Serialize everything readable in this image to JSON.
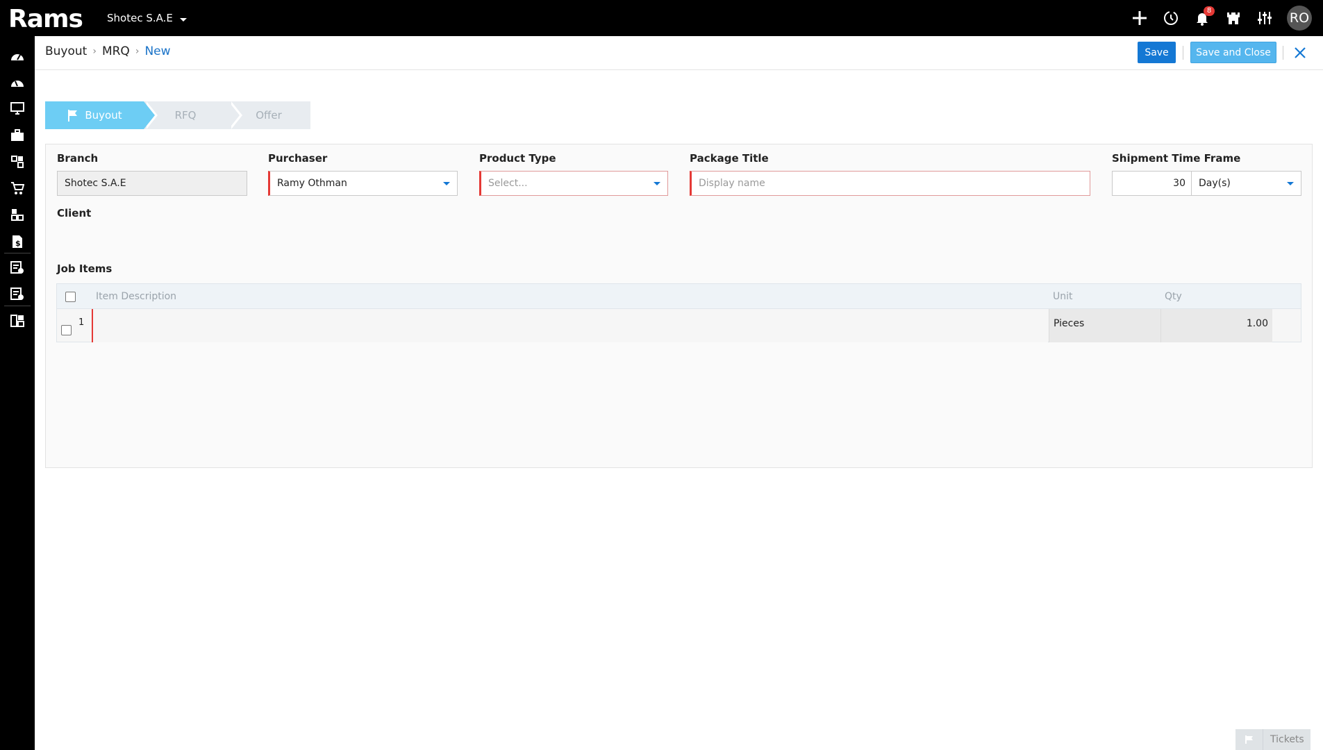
{
  "app": {
    "logo_text": "Rams",
    "company": "Shotec S.A.E",
    "notification_count": "8",
    "user_initials": "RO"
  },
  "sidebar": {
    "items": [
      {
        "icon": "dashboard-icon"
      },
      {
        "icon": "dashboard-alt-icon"
      },
      {
        "icon": "monitor-icon"
      },
      {
        "icon": "briefcase-icon"
      },
      {
        "icon": "modules-icon"
      },
      {
        "icon": "cart-icon"
      },
      {
        "icon": "modules-alt-icon"
      },
      {
        "icon": "invoice-dollar-icon"
      },
      {
        "icon": "approved-list-icon"
      },
      {
        "icon": "settings-list-icon"
      },
      {
        "icon": "grid-layout-icon"
      }
    ]
  },
  "header": {
    "breadcrumb": [
      "Buyout",
      "MRQ",
      "New"
    ],
    "save_label": "Save",
    "save_close_label": "Save and Close"
  },
  "stepper": {
    "steps": [
      "Buyout",
      "RFQ",
      "Offer"
    ],
    "active_index": 0
  },
  "form": {
    "branch": {
      "label": "Branch",
      "value": "Shotec S.A.E"
    },
    "purchaser": {
      "label": "Purchaser",
      "value": "Ramy  Othman"
    },
    "product_type": {
      "label": "Product Type",
      "placeholder": "Select..."
    },
    "package_title": {
      "label": "Package Title",
      "placeholder": "Display name"
    },
    "shipment": {
      "label": "Shipment Time Frame",
      "value": "30",
      "unit": "Day(s)"
    },
    "client": {
      "label": "Client"
    }
  },
  "job_items": {
    "title": "Job Items",
    "columns": [
      "Item Description",
      "Unit",
      "Qty"
    ],
    "rows": [
      {
        "index": "1",
        "description": "",
        "unit": "Pieces",
        "qty": "1.00"
      }
    ]
  },
  "footer": {
    "tickets_label": "Tickets"
  },
  "colors": {
    "primary": "#1478d4",
    "secondary": "#55b6ee",
    "step_active": "#6dcdf4",
    "required": "#e53935"
  }
}
